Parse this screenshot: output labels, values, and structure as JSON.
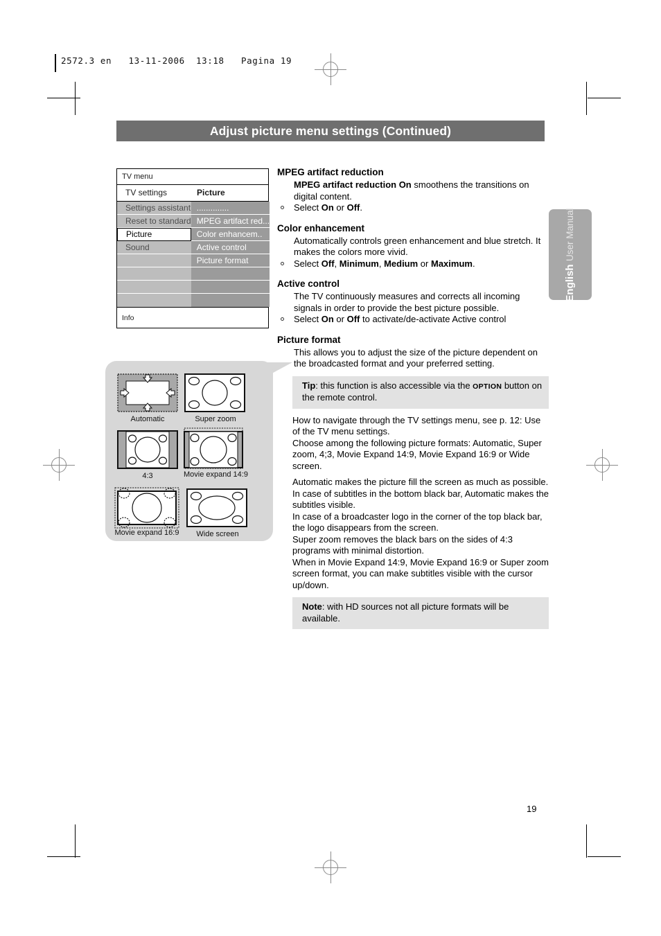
{
  "header_slug": "2572.3 en   13-11-2006  13:18   Pagina 19",
  "banner": {
    "title": "Adjust picture menu settings  (Continued)"
  },
  "tv_menu": {
    "title": "TV menu",
    "sub_left": "TV settings",
    "sub_right": "Picture",
    "left_items": [
      "Settings assistant",
      "Reset to standard",
      "Picture",
      "Sound",
      "",
      "",
      ""
    ],
    "selected_left": "Picture",
    "right_items": [
      "..............",
      "MPEG artifact red...",
      "Color enhancem..",
      "Active control",
      "Picture format",
      "",
      ""
    ],
    "info": "Info",
    "colors": {
      "left_column": "#bdbdbd",
      "right_column": "#9b9b9b",
      "selected": "#ffffff"
    }
  },
  "picture_formats": {
    "panel_color": "#d7d7d7",
    "items": [
      {
        "caption": "Automatic",
        "kind": "automatic"
      },
      {
        "caption": "Super zoom",
        "kind": "super-zoom"
      },
      {
        "caption": "4:3",
        "kind": "four-three"
      },
      {
        "caption": "Movie expand 14:9",
        "kind": "movie-expand-14-9"
      },
      {
        "caption": "Movie expand 16:9",
        "kind": "movie-expand-16-9"
      },
      {
        "caption": "Wide screen",
        "kind": "wide-screen"
      }
    ]
  },
  "sections": {
    "mpeg": {
      "heading": "MPEG artifact reduction",
      "lead_bold": "MPEG artifact reduction On",
      "lead_rest": " smoothens the transitions on digital content.",
      "bullet_pre": "Select ",
      "bullet_b1": "On",
      "bullet_mid": " or ",
      "bullet_b2": "Off",
      "bullet_post": "."
    },
    "color": {
      "heading": "Color enhancement",
      "body": "Automatically controls green enhancement and blue stretch. It makes the colors more vivid.",
      "bullet_pre": "Select ",
      "bullet_b1": "Off",
      "bullet_s1": ", ",
      "bullet_b2": "Minimum",
      "bullet_s2": ", ",
      "bullet_b3": "Medium",
      "bullet_s3": " or ",
      "bullet_b4": "Maximum",
      "bullet_post": "."
    },
    "active": {
      "heading": "Active control",
      "body": "The TV continuously measures and corrects all incoming signals in order to provide the best picture possible.",
      "bullet_pre": "Select ",
      "bullet_b1": "On",
      "bullet_mid": " or ",
      "bullet_b2": "Off",
      "bullet_post": " to activate/de-activate Active control"
    },
    "format": {
      "heading": "Picture format",
      "body": "This allows you to adjust the size of the picture dependent on the broadcasted format and your preferred setting.",
      "tip_label": "Tip",
      "tip_pre": ": this function is also accessible via the ",
      "tip_sc": "OPTION",
      "tip_post": " button on the remote control.",
      "para1": "How to navigate through the TV settings menu, see p. 12: Use of the TV menu settings.",
      "para2": "Choose among the following picture formats: Automatic, Super zoom, 4;3, Movie Expand 14:9, Movie Expand 16:9 or Wide screen.",
      "para3": "Automatic makes the picture fill the screen as much as possible.",
      "para4": "In case of subtitles in the bottom black bar, Automatic makes the subtitles visible.",
      "para5": "In case of a broadcaster logo in the corner of the top black bar, the logo disappears from the screen.",
      "para6": "Super zoom removes the black bars on the sides of 4:3 programs with minimal distortion.",
      "para7": "When in Movie Expand 14:9, Movie Expand 16:9 or Super zoom screen format, you can make subtitles visible with the cursor up/down.",
      "note_label": "Note",
      "note_text": ": with HD sources not all picture formats will be available."
    }
  },
  "side_tab": {
    "language": "English",
    "subtitle": "User Manual"
  },
  "page_number": "19"
}
